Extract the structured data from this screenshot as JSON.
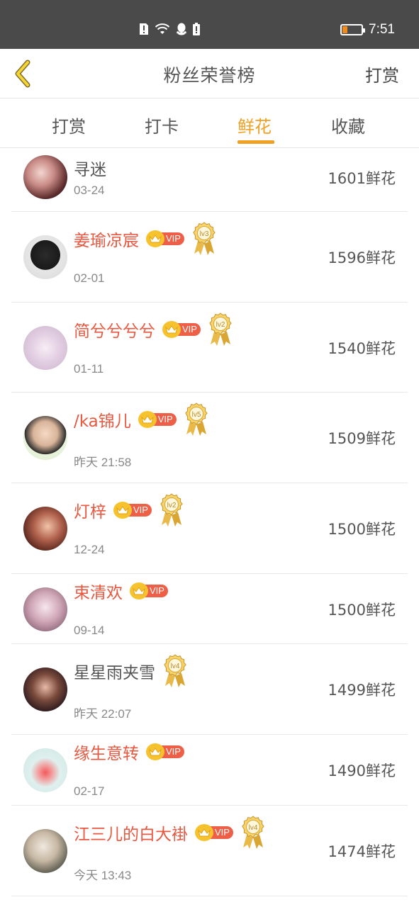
{
  "status_bar": {
    "time": "7:51",
    "battery_level": 0.25,
    "icons": [
      "sim-alert-icon",
      "wifi-icon",
      "qq-icon",
      "battery-alert-icon"
    ]
  },
  "header": {
    "back_icon": "chevron-left-icon",
    "title": "粉丝荣誉榜",
    "action": "打赏"
  },
  "tabs": [
    {
      "label": "打赏",
      "active": false
    },
    {
      "label": "打卡",
      "active": false
    },
    {
      "label": "鲜花",
      "active": true
    },
    {
      "label": "收藏",
      "active": false
    }
  ],
  "vip_label": "VIP",
  "rows": [
    {
      "name": "寻迷",
      "time": "03-24",
      "amount": "1601鲜花",
      "vip": false,
      "level": null
    },
    {
      "name": "姜瑜凉宸",
      "time": "02-01",
      "amount": "1596鲜花",
      "vip": true,
      "level": "lv3"
    },
    {
      "name": "简兮兮兮兮",
      "time": "01-11",
      "amount": "1540鲜花",
      "vip": true,
      "level": "lv2"
    },
    {
      "name": "/ka锦儿",
      "time": "昨天 21:58",
      "amount": "1509鲜花",
      "vip": true,
      "level": "lv5"
    },
    {
      "name": "灯梓",
      "time": "12-24",
      "amount": "1500鲜花",
      "vip": true,
      "level": "lv2"
    },
    {
      "name": "束清欢",
      "time": "09-14",
      "amount": "1500鲜花",
      "vip": true,
      "level": null
    },
    {
      "name": "星星雨夹雪",
      "time": "昨天 22:07",
      "amount": "1499鲜花",
      "vip": false,
      "level": "lv4"
    },
    {
      "name": "缘生意转",
      "time": "02-17",
      "amount": "1490鲜花",
      "vip": true,
      "level": null
    },
    {
      "name": "江三儿的白大褂",
      "time": "今天 13:43",
      "amount": "1474鲜花",
      "vip": true,
      "level": "lv4"
    }
  ],
  "colors": {
    "accent": "#f0a023",
    "vip_name": "#e8573f",
    "vip_tag": "#ee5f48",
    "status_bar": "#4a4a4a"
  }
}
